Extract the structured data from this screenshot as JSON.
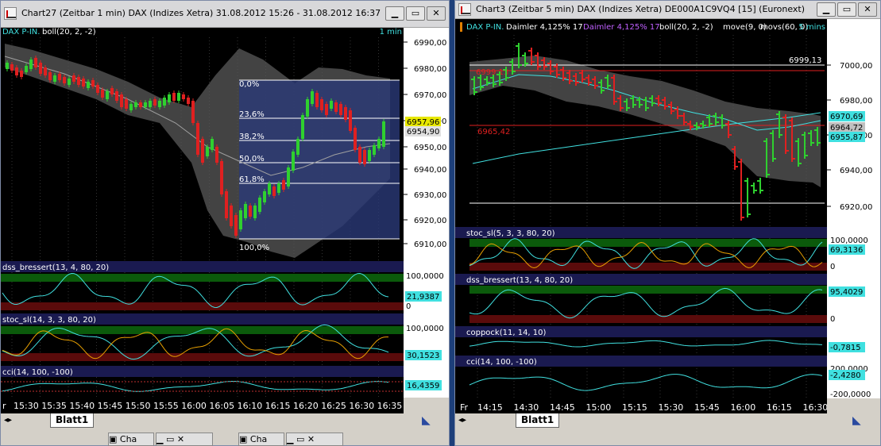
{
  "windows": [
    {
      "title": "Chart27 (Zeitbar 1 min)  DAX (Indizes Xetra) 31.08.2012 15:26 - 31.08.2012 16:37",
      "legend": {
        "symbol": "DAX P-IN.",
        "boll": "boll(20, 2, -2)",
        "interval": "1 min"
      },
      "price_axis": [
        "6990,00",
        "6980,00",
        "6970,00",
        "6960,00",
        "6950,00",
        "6940,00",
        "6930,00",
        "6920,00",
        "6910,00"
      ],
      "price_tags": [
        "6957,96",
        "6954,90"
      ],
      "fib_levels": [
        "0,0%",
        "23,6%",
        "38,2%",
        "50,0%",
        "61,8%",
        "100,0%"
      ],
      "indicators": [
        {
          "label": "dss_bressert(13, 4, 80, 20)",
          "axis": [
            "100,0000",
            "0"
          ],
          "value": "21,9387"
        },
        {
          "label": "stoc_sl(14, 3, 3, 80, 20)",
          "axis": [
            "100,0000",
            "0"
          ],
          "value": "30,1523"
        },
        {
          "label": "cci(14, 100, -100)",
          "axis": [],
          "value": "16,4359"
        }
      ],
      "time_axis": [
        "r",
        "15:30",
        "15:35",
        "15:40",
        "15:45",
        "15:50",
        "15:55",
        "16:00",
        "16:05",
        "16:10",
        "16:15",
        "16:20",
        "16:25",
        "16:30",
        "16:35"
      ],
      "sheet_tab": "Blatt1"
    },
    {
      "title": "Chart3 (Zeitbar 5 min)  DAX (Indizes Xetra) DE000A1C9VQ4 [15] (Euronext)",
      "legend": {
        "symbol": "DAX P-IN.",
        "s1": "Daimler  4,125% 17",
        "s2": "Daimler  4,125% 17",
        "boll": "boll(20, 2, -2)",
        "move": "move(9, 0)",
        "movs": "movs(60, 0)",
        "interval": "5 mins"
      },
      "price_axis": [
        "7000,00",
        "6980,00",
        "6960,00",
        "6940,00",
        "6920,00"
      ],
      "price_tags": [
        "6970,69",
        "6964,72",
        "6955,87"
      ],
      "line_labels": [
        "6999,13",
        "6999,13",
        "6965,42"
      ],
      "indicators": [
        {
          "label": "stoc_sl(5, 3, 3, 80, 20)",
          "axis": [
            "100,0000",
            "0"
          ],
          "value": "69,3136"
        },
        {
          "label": "dss_bressert(13, 4, 80, 20)",
          "axis": [
            "0"
          ],
          "value": "95,4029"
        },
        {
          "label": "coppock(11, 14, 10)",
          "axis": [],
          "value": "-0,7815"
        },
        {
          "label": "cci(14, 100, -100)",
          "axis": [
            "200,0000",
            "-200,0000"
          ],
          "value": "-2,4280"
        }
      ],
      "time_axis": [
        "Fr",
        "14:15",
        "14:30",
        "14:45",
        "15:00",
        "15:15",
        "15:30",
        "15:45",
        "16:00",
        "16:15",
        "16:30"
      ],
      "sheet_tab": "Blatt1"
    }
  ],
  "taskbar": [
    "Cha",
    "Cha"
  ],
  "colors": {
    "bull": "#2fd02f",
    "bear": "#e02020",
    "band": "#7a7a7a",
    "fib": "#2a3a78",
    "cyan": "#40e0e0",
    "axis_bg": "#ffffff"
  }
}
